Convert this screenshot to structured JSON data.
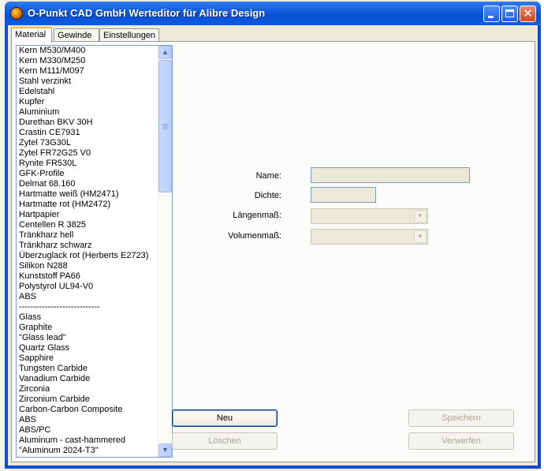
{
  "window": {
    "title": "O-Punkt CAD GmbH Werteditor für Alibre Design"
  },
  "tabs": [
    {
      "label": "Material",
      "active": true
    },
    {
      "label": "Gewinde",
      "active": false
    },
    {
      "label": "Einstellungen",
      "active": false
    }
  ],
  "materials": [
    "Kern M530/M400",
    "Kern M330/M250",
    "Kern M111/M097",
    "Stahl verzinkt",
    "Edelstahl",
    "Kupfer",
    "Aluminium",
    "Durethan BKV 30H",
    "Crastin CE7931",
    "Zytel 73G30L",
    "Zytel FR72G25 V0",
    "Rynite FR530L",
    "GFK-Profile",
    "Delmat 68.160",
    "Hartmatte weiß (HM2471)",
    "Hartmatte rot (HM2472)",
    "Hartpapier",
    "Centellen R 3825",
    "Tränkharz hell",
    "Tränkharz schwarz",
    "Überzuglack rot (Herberts E2723)",
    "Silikon N288",
    "Kunststoff PA66",
    "Polystyrol UL94-V0",
    "ABS",
    "----------------------------",
    "Glass",
    "Graphite",
    "\"Glass lead\"",
    "Quartz Glass",
    "Sapphire",
    "Tungsten Carbide",
    "Vanadium Carbide",
    "Zirconia",
    "Zirconium Carbide",
    "Carbon-Carbon Composite",
    "ABS",
    "ABS/PC",
    "Aluminum - cast-hammered",
    "\"Aluminum 2024-T3\""
  ],
  "form": {
    "name_label": "Name:",
    "name_value": "",
    "density_label": "Dichte:",
    "density_value": "",
    "length_unit_label": "Längenmaß:",
    "length_unit_value": "",
    "volume_unit_label": "Volumenmaß:",
    "volume_unit_value": ""
  },
  "buttons": {
    "new": "Neu",
    "delete": "Löschen",
    "save": "Speichern",
    "discard": "Verwerfen"
  },
  "icons": {
    "app": "alibre-app-icon",
    "minimize": "minimize-icon",
    "maximize": "maximize-icon",
    "close": "close-icon",
    "scroll_up": "chevron-up-icon",
    "scroll_down": "chevron-down-icon"
  }
}
